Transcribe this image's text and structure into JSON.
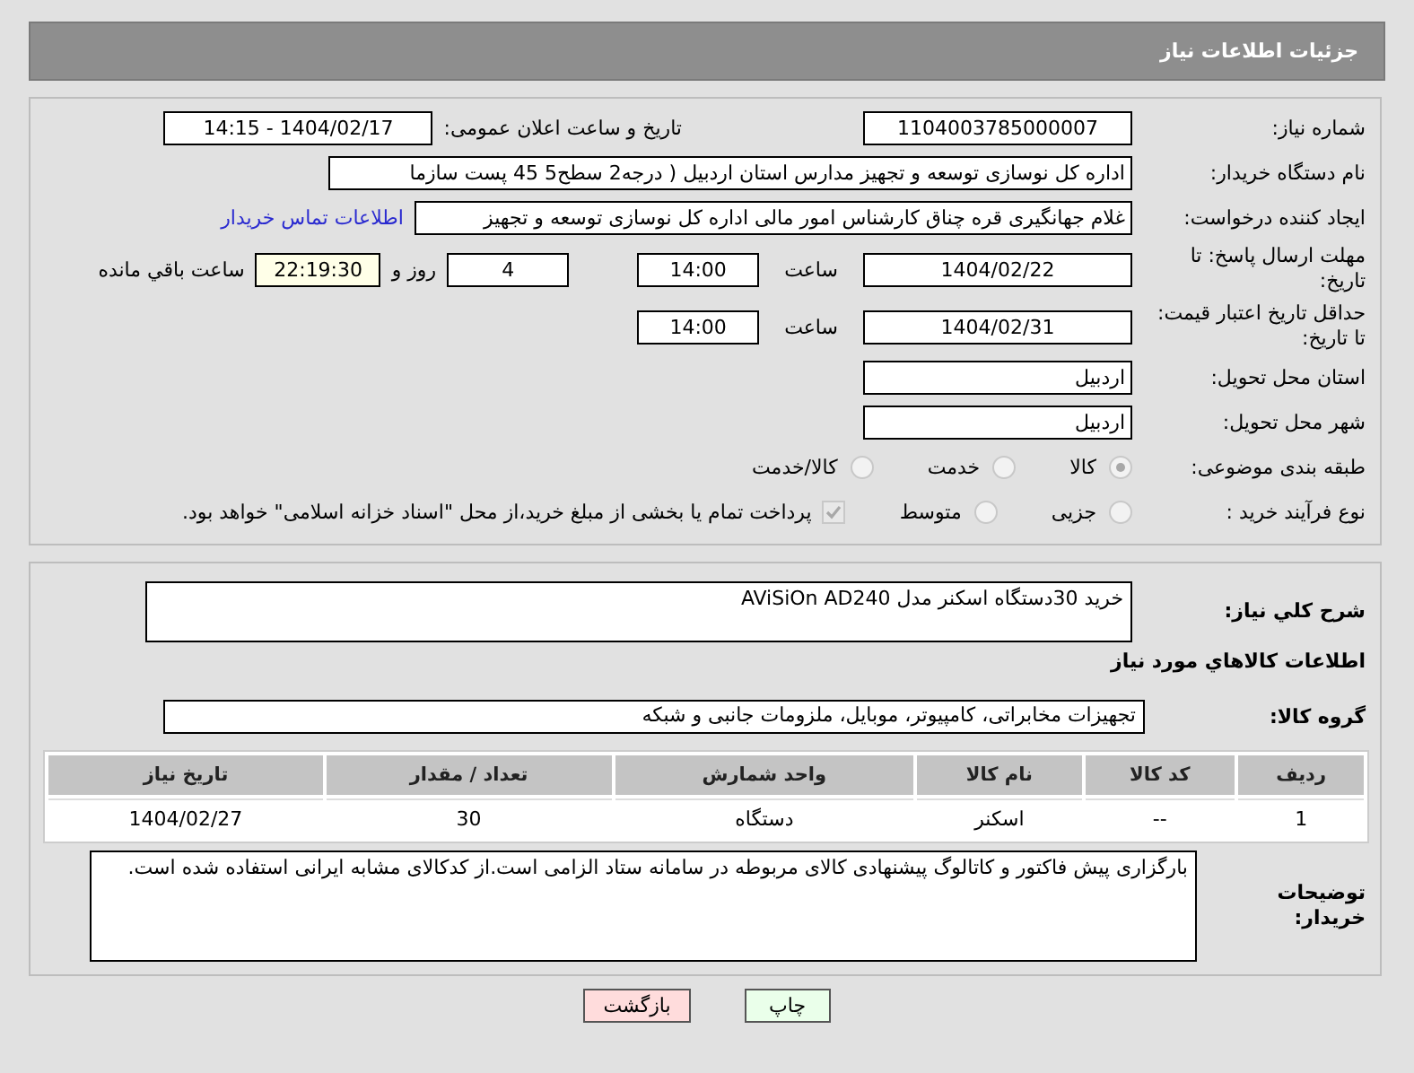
{
  "header": {
    "title": "جزئیات اطلاعات نیاز"
  },
  "need_number": {
    "label": "شماره نیاز:",
    "value": "1104003785000007"
  },
  "announce": {
    "label": "تاریخ و ساعت اعلان عمومی:",
    "value": "1404/02/17 - 14:15"
  },
  "buyer_org": {
    "label": "نام دستگاه خریدار:",
    "value": "اداره کل نوسازی   توسعه و تجهیز مدارس استان اردبیل ( درجه2  سطح5  45 پست سازما"
  },
  "creator": {
    "label": "ایجاد کننده درخواست:",
    "value": "غلام جهانگیری قره چناق کارشناس امور مالی اداره کل نوسازی   توسعه و تجهیز",
    "link": "اطلاعات تماس خریدار"
  },
  "reply_deadline": {
    "label": "مهلت ارسال پاسخ: تا تاریخ:",
    "date": "1404/02/22",
    "time_label": "ساعت",
    "time": "14:00",
    "days": "4",
    "days_label": "روز و",
    "remaining": "22:19:30",
    "remaining_label": "ساعت باقي مانده"
  },
  "price_validity": {
    "label": "حداقل تاریخ اعتبار قیمت: تا تاریخ:",
    "date": "1404/02/31",
    "time_label": "ساعت",
    "time": "14:00"
  },
  "province": {
    "label": "استان محل تحویل:",
    "value": "اردبیل"
  },
  "city": {
    "label": "شهر محل تحویل:",
    "value": "اردبیل"
  },
  "category": {
    "label": "طبقه بندی موضوعی:",
    "options": [
      {
        "label": "کالا",
        "selected": true
      },
      {
        "label": "خدمت",
        "selected": false
      },
      {
        "label": "کالا/خدمت",
        "selected": false
      }
    ]
  },
  "purchase_type": {
    "label": "نوع فرآیند خرید :",
    "options": [
      {
        "label": "جزیی",
        "selected": false
      },
      {
        "label": "متوسط",
        "selected": false
      }
    ],
    "treasury": {
      "checked": true,
      "label": "پرداخت تمام یا بخشی از مبلغ خرید،از محل \"اسناد خزانه اسلامی\" خواهد بود."
    }
  },
  "description": {
    "label": "شرح کلي نياز:",
    "value": "خرید 30دستگاه اسکنر مدل  AViSiOn AD240"
  },
  "goods_heading": "اطلاعات کالاهاي مورد نياز",
  "goods_group": {
    "label": "گروه کالا:",
    "value": "تجهیزات مخابراتی، کامپیوتر، موبایل، ملزومات جانبی و شبکه"
  },
  "table": {
    "columns": [
      "ردیف",
      "کد کالا",
      "نام کالا",
      "واحد شمارش",
      "تعداد / مقدار",
      "تاریخ نیاز"
    ],
    "rows": [
      [
        "1",
        "--",
        "اسکنر",
        "دستگاه",
        "30",
        "1404/02/27"
      ]
    ]
  },
  "buyer_notes": {
    "label": "توضیحات خریدار:",
    "value": "بارگزاری پیش فاکتور و کاتالوگ پیشنهادی کالای مربوطه در سامانه ستاد الزامی است.از کدکالای مشابه ایرانی استفاده شده است."
  },
  "buttons": [
    {
      "label": "چاپ",
      "kind": "print"
    },
    {
      "label": "بازگشت",
      "kind": "back"
    }
  ]
}
